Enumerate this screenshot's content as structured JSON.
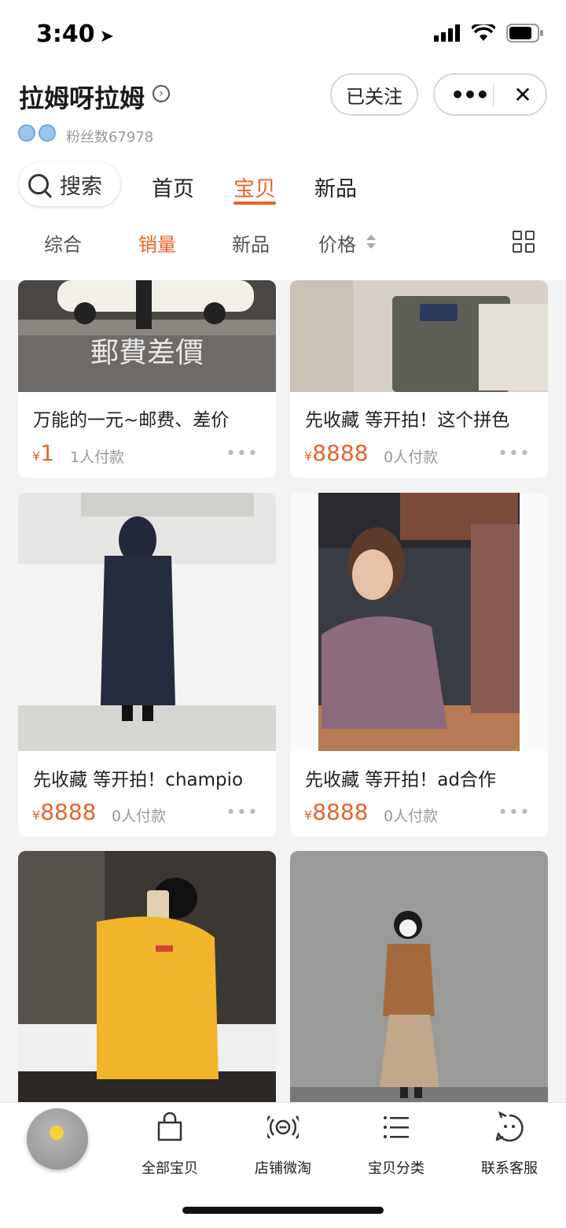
{
  "status_bar": {
    "time": "3:40"
  },
  "header": {
    "shop_name": "拉姆呀拉姆",
    "follow_label": "已关注",
    "fans_label": "粉丝数67978"
  },
  "nav": {
    "search_label": "搜索",
    "tabs": [
      {
        "label": "首页",
        "active": false
      },
      {
        "label": "宝贝",
        "active": true
      },
      {
        "label": "新品",
        "active": false
      }
    ]
  },
  "filters": {
    "items": [
      {
        "label": "综合",
        "active": false
      },
      {
        "label": "销量",
        "active": true
      },
      {
        "label": "新品",
        "active": false
      },
      {
        "label": "价格",
        "active": false
      }
    ]
  },
  "products": [
    {
      "title": "万能的一元~邮费、差价",
      "currency": "¥",
      "price": "1",
      "sold": "1人付款",
      "image_text": "郵費差價"
    },
    {
      "title": "先收藏 等开拍！这个拼色",
      "currency": "¥",
      "price": "8888",
      "sold": "0人付款"
    },
    {
      "title": "先收藏 等开拍！champio",
      "currency": "¥",
      "price": "8888",
      "sold": "0人付款"
    },
    {
      "title": "先收藏 等开拍！ad合作",
      "currency": "¥",
      "price": "8888",
      "sold": "0人付款"
    }
  ],
  "bottom_bar": {
    "items": [
      {
        "label": "全部宝贝",
        "icon": "bag-icon"
      },
      {
        "label": "店铺微淘",
        "icon": "broadcast-icon"
      },
      {
        "label": "宝贝分类",
        "icon": "list-icon"
      },
      {
        "label": "联系客服",
        "icon": "chat-face-icon"
      }
    ]
  },
  "colors": {
    "accent": "#e8622a"
  }
}
